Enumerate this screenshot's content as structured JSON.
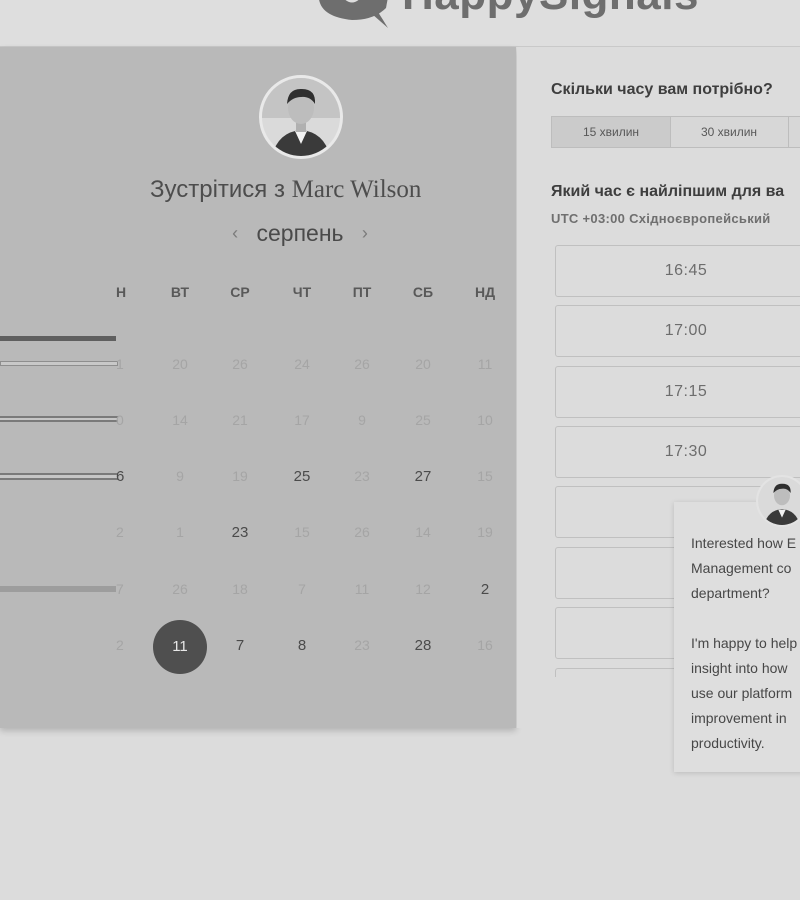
{
  "brand": {
    "name": "HappySignals"
  },
  "host": {
    "prefix": "Зустрітися з",
    "name": "Marc Wilson"
  },
  "calendar": {
    "month": "серпень",
    "weekdays": [
      "Н",
      "ВТ",
      "СР",
      "ЧТ",
      "ПТ",
      "СБ",
      "НД"
    ],
    "rows": [
      [
        {
          "t": "1",
          "s": "faded"
        },
        {
          "t": "20",
          "s": "faded"
        },
        {
          "t": "26",
          "s": "faded"
        },
        {
          "t": "24",
          "s": "faded"
        },
        {
          "t": "26",
          "s": "faded"
        },
        {
          "t": "20",
          "s": "faded"
        },
        {
          "t": "11",
          "s": "faded"
        }
      ],
      [
        {
          "t": "0",
          "s": "faded"
        },
        {
          "t": "14",
          "s": "faded"
        },
        {
          "t": "21",
          "s": "faded"
        },
        {
          "t": "17",
          "s": "faded"
        },
        {
          "t": "9",
          "s": "faded"
        },
        {
          "t": "25",
          "s": "faded"
        },
        {
          "t": "10",
          "s": "faded"
        }
      ],
      [
        {
          "t": "6",
          "s": "avail"
        },
        {
          "t": "9",
          "s": "faded"
        },
        {
          "t": "19",
          "s": "faded"
        },
        {
          "t": "25",
          "s": "avail"
        },
        {
          "t": "23",
          "s": "faded"
        },
        {
          "t": "27",
          "s": "avail"
        },
        {
          "t": "15",
          "s": "faded"
        }
      ],
      [
        {
          "t": "2",
          "s": "faded"
        },
        {
          "t": "1",
          "s": "faded"
        },
        {
          "t": "23",
          "s": "avail"
        },
        {
          "t": "15",
          "s": "faded"
        },
        {
          "t": "26",
          "s": "faded"
        },
        {
          "t": "14",
          "s": "faded"
        },
        {
          "t": "19",
          "s": "faded"
        }
      ],
      [
        {
          "t": "7",
          "s": "faded"
        },
        {
          "t": "26",
          "s": "faded"
        },
        {
          "t": "18",
          "s": "faded"
        },
        {
          "t": "7",
          "s": "faded"
        },
        {
          "t": "11",
          "s": "faded"
        },
        {
          "t": "12",
          "s": "faded"
        },
        {
          "t": "2",
          "s": "avail"
        }
      ],
      [
        {
          "t": "2",
          "s": "faded"
        },
        {
          "t": "11",
          "s": "selected"
        },
        {
          "t": "7",
          "s": "avail"
        },
        {
          "t": "8",
          "s": "avail"
        },
        {
          "t": "23",
          "s": "faded"
        },
        {
          "t": "28",
          "s": "avail"
        },
        {
          "t": "16",
          "s": "faded"
        }
      ]
    ]
  },
  "duration": {
    "question": "Скільки часу вам потрібно?",
    "options": [
      "15 хвилин",
      "30 хвилин"
    ],
    "selected": "15 хвилин"
  },
  "time": {
    "question": "Який час є найліпшим для ва",
    "timezone": "UTC +03:00 Східноєвропейський",
    "slots": [
      "16:45",
      "17:00",
      "17:15",
      "17:30",
      "",
      "",
      "",
      ""
    ]
  },
  "chat": {
    "lines": [
      "Interested how E",
      "Management co",
      "department?",
      "",
      "I'm happy to help",
      "insight into how",
      "use our platform",
      "improvement in",
      "productivity."
    ]
  }
}
